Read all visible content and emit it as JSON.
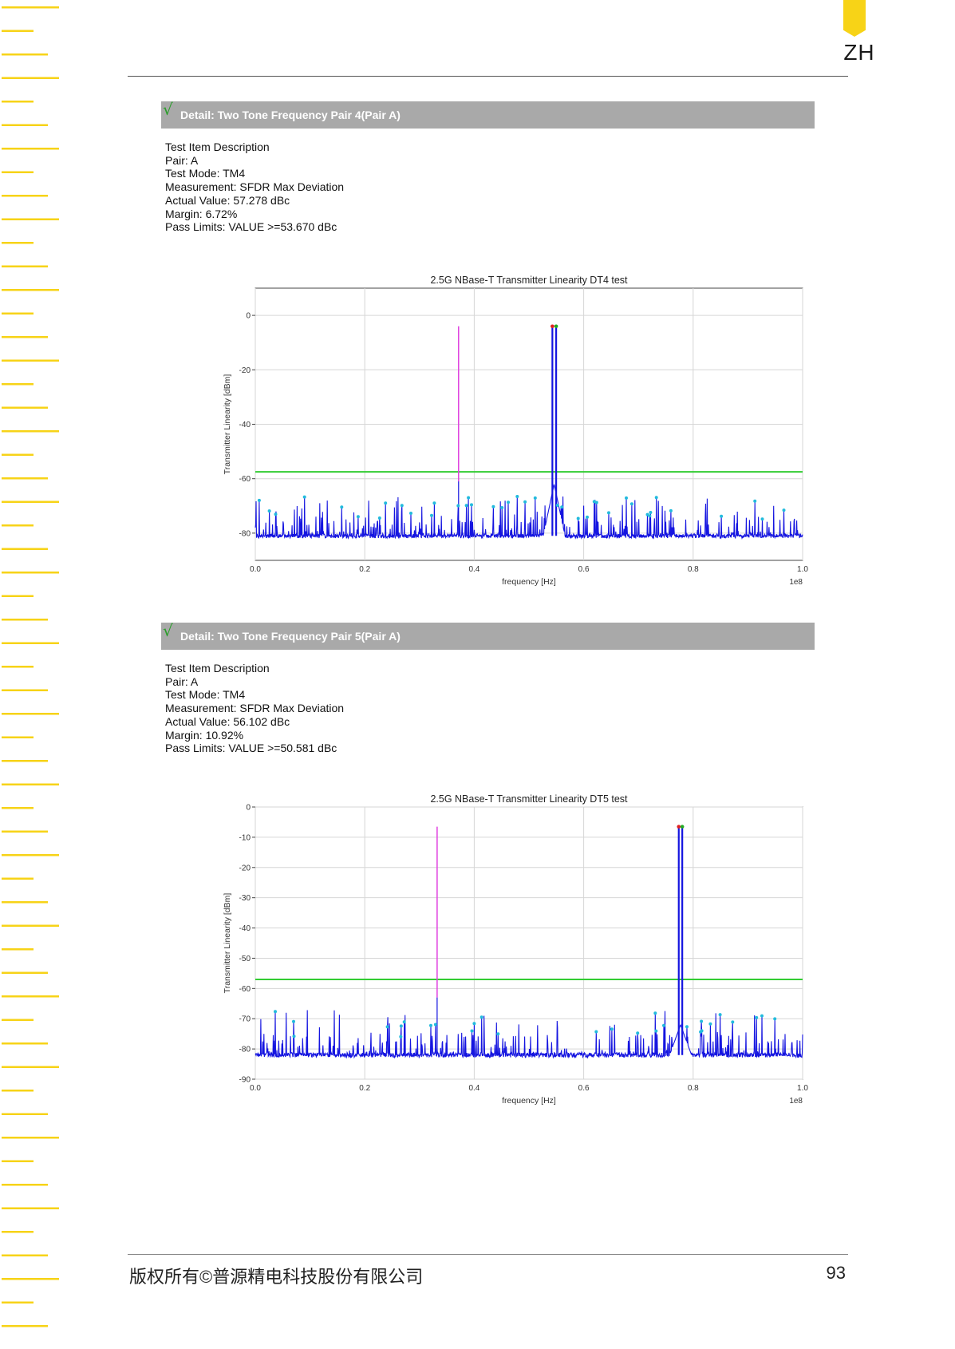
{
  "logo": {
    "text": "ZH",
    "color": "#f7d317"
  },
  "footer": {
    "copyright": "版权所有©普源精电科技股份有限公司",
    "page_number": "93"
  },
  "sections": [
    {
      "title": "Detail: Two Tone Frequency Pair 4(Pair A)",
      "check": "√",
      "description": [
        "Test Item Description",
        "Pair: A",
        "Test Mode: TM4",
        "Measurement: SFDR Max Deviation",
        "Actual Value: 57.278 dBc",
        "Margin: 6.72%",
        "Pass Limits: VALUE >=53.670 dBc"
      ]
    },
    {
      "title": "Detail: Two Tone Frequency Pair 5(Pair A)",
      "check": "√",
      "description": [
        "Test Item Description",
        "Pair: A",
        "Test Mode: TM4",
        "Measurement: SFDR Max Deviation",
        "Actual Value: 56.102 dBc",
        "Margin: 10.92%",
        "Pass Limits: VALUE >=50.581 dBc"
      ]
    }
  ],
  "chart_data": [
    {
      "type": "line",
      "title": "2.5G NBase-T Transmitter Linearity DT4 test",
      "xlabel": "frequency [Hz]",
      "ylabel": "Transmitter Linearity [dBm]",
      "x_scale_label": "1e8",
      "xlim": [
        0.0,
        1.0
      ],
      "ylim": [
        -90,
        10
      ],
      "xticks": [
        "0.0",
        "0.2",
        "0.4",
        "0.6",
        "0.8",
        "1.0"
      ],
      "yticks": [
        "0",
        "-20",
        "-40",
        "-60",
        "-80"
      ],
      "ytick_values": [
        0,
        -20,
        -40,
        -60,
        -80
      ],
      "grid": true,
      "noise_floor": -81,
      "limit_line": -57.5,
      "tones": [
        {
          "x": 0.5428,
          "y": -4
        },
        {
          "x": 0.5497,
          "y": -4
        }
      ],
      "spur": {
        "x": 0.3714,
        "y": -4,
        "base": -61
      },
      "hump": {
        "x": 0.546,
        "peak": -62
      },
      "colors": {
        "trace": "#1515e0",
        "limit": "#33cc33",
        "spur": "#e040e0",
        "marker": "#22bbdd",
        "tone_marker_1": "#e02020",
        "tone_marker_2": "#22aa22"
      }
    },
    {
      "type": "line",
      "title": "2.5G NBase-T Transmitter Linearity DT5 test",
      "xlabel": "frequency [Hz]",
      "ylabel": "Transmitter Linearity [dBm]",
      "x_scale_label": "1e8",
      "xlim": [
        0.0,
        1.0
      ],
      "ylim": [
        -90,
        0
      ],
      "xticks": [
        "0.0",
        "0.2",
        "0.4",
        "0.6",
        "0.8",
        "1.0"
      ],
      "yticks": [
        "0",
        "-10",
        "-20",
        "-30",
        "-40",
        "-50",
        "-60",
        "-70",
        "-80",
        "-90"
      ],
      "ytick_values": [
        0,
        -10,
        -20,
        -30,
        -40,
        -50,
        -60,
        -70,
        -80,
        -90
      ],
      "grid": true,
      "noise_floor": -82,
      "limit_line": -57,
      "tones": [
        {
          "x": 0.7737,
          "y": -6.5
        },
        {
          "x": 0.7801,
          "y": -6.5
        }
      ],
      "spur": {
        "x": 0.3322,
        "y": -6.5,
        "base": -63
      },
      "hump": {
        "x": 0.777,
        "peak": -72
      },
      "colors": {
        "trace": "#1515e0",
        "limit": "#33cc33",
        "spur": "#e040e0",
        "marker": "#22bbdd",
        "tone_marker_1": "#e02020",
        "tone_marker_2": "#22aa22"
      }
    }
  ]
}
